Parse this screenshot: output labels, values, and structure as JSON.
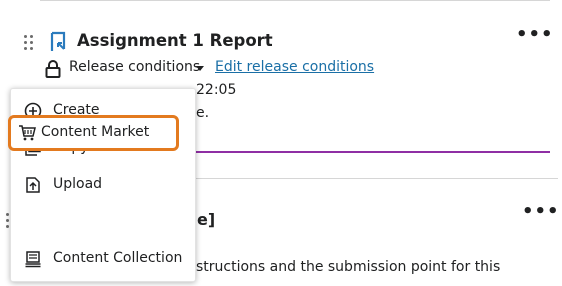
{
  "item1": {
    "title": "Assignment 1 Report",
    "release_label": "Release conditions",
    "edit_link": "Edit release conditions",
    "time_fragment": "22:05",
    "text_fragment": "e."
  },
  "item2": {
    "title_fragment": "e]",
    "desc_line1": "structions and the submission point for this",
    "desc_line2": ""
  },
  "menu": {
    "items": [
      {
        "label": "Create",
        "icon": "plus-circle-icon"
      },
      {
        "label": "Copy Content",
        "icon": "copy-icon"
      },
      {
        "label": "Upload",
        "icon": "upload-icon"
      },
      {
        "label": "Content Market",
        "icon": "cart-icon"
      },
      {
        "label": "Content Collection",
        "icon": "collection-icon"
      }
    ]
  },
  "colors": {
    "accent_purple": "#8f2fa4",
    "highlight_orange": "#e37a1f",
    "link_blue": "#1a6fa6",
    "icon_blue": "#2b7bbd"
  }
}
